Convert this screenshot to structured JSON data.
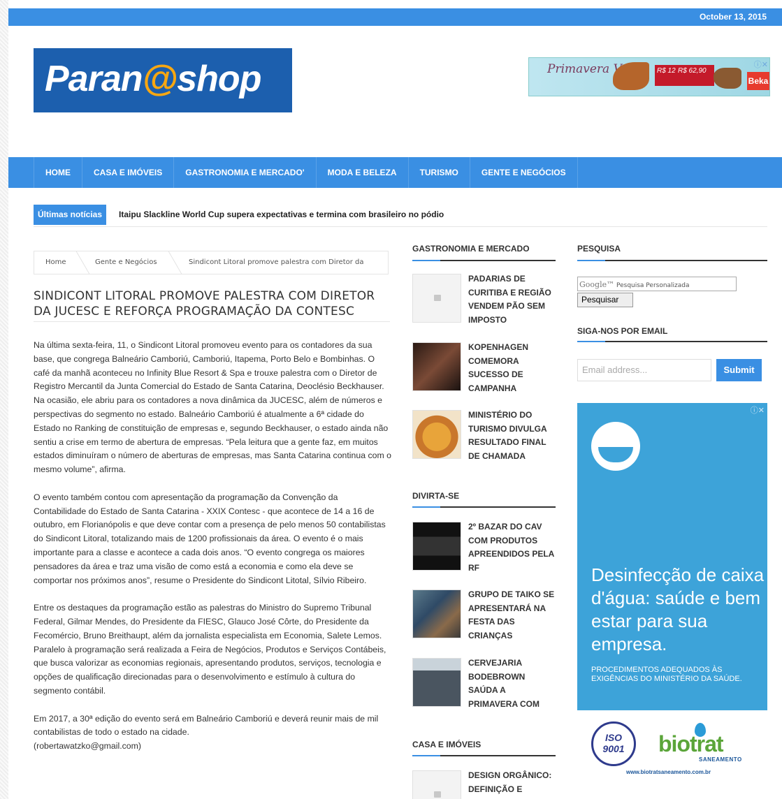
{
  "header": {
    "date": "October 13, 2015",
    "logo_text_1": "Paran",
    "logo_text_2": "@shop",
    "logo_text_3": "shop"
  },
  "top_ad": {
    "script_text": "Primavera Verão",
    "price_1": "R$ 123,50",
    "price_2": "R$ 62,90",
    "brand": "Beka",
    "info_icon": "ⓘ✕"
  },
  "nav": {
    "items": [
      "HOME",
      "CASA E IMÓVEIS",
      "GASTRONOMIA E MERCADO'",
      "MODA E BELEZA",
      "TURISMO",
      "GENTE E NEGÓCIOS"
    ]
  },
  "ticker": {
    "label": "Últimas notícias",
    "headline": "Itaipu Slackline World Cup supera expectativas e termina com brasileiro no pódio"
  },
  "breadcrumb": {
    "home": "Home",
    "section": "Gente e Negócios",
    "current": "Sindicont Litoral promove palestra com Diretor da"
  },
  "article": {
    "title": "SINDICONT LITORAL PROMOVE PALESTRA COM DIRETOR DA JUCESC E REFORÇA PROGRAMAÇÃO DA CONTESC",
    "paragraphs": [
      "Na última sexta-feira, 11, o Sindicont Litoral promoveu evento para os contadores da sua base, que congrega Balneário Camboriú, Camboriú, Itapema, Porto Belo e Bombinhas. O café da manhã aconteceu no Infinity Blue Resort & Spa e trouxe palestra com o Diretor de Registro Mercantil da Junta Comercial do Estado de Santa Catarina, Deoclésio Beckhauser. Na ocasião, ele abriu para os contadores a nova dinâmica da JUCESC, além de números e perspectivas do segmento no estado. Balneário Camboriú é atualmente a 6ª cidade do Estado no Ranking de constituição de empresas e, segundo Beckhauser, o estado ainda não sentiu a crise em termo de abertura de empresas. “Pela leitura que a gente faz, em muitos estados diminuíram o número de aberturas de empresas, mas Santa Catarina continua com o mesmo volume”, afirma.",
      "O evento também contou com apresentação da programação da Convenção da Contabilidade do Estado de Santa Catarina - XXIX Contesc - que acontece de 14 a 16 de outubro, em Florianópolis e que deve contar com a presença de pelo menos 50 contabilistas do Sindicont Litoral, totalizando mais de 1200 profissionais da área. O evento é o mais importante para a classe e acontece a cada dois anos. “O evento congrega os maiores pensadores da área e traz uma visão de como está a economia e como ela deve se comportar nos próximos anos”, resume o Presidente do Sindicont Litotal, Sílvio Ribeiro.",
      "Entre os destaques da programação estão as palestras do Ministro do Supremo Tribunal Federal, Gilmar Mendes, do Presidente da FIESC, Glauco José Côrte, do Presidente da Fecomércio, Bruno Breithaupt, além da jornalista especialista em Economia, Salete Lemos. Paralelo à programação será realizada a Feira de Negócios, Produtos e Serviços Contábeis, que busca valorizar as economias regionais, apresentando produtos, serviços, tecnologia e opções de qualificação direcionadas para o desenvolvimento e estímulo à cultura do segmento contábil.",
      "Em 2017, a 30ª edição do evento será em Balneário Camboriú e deverá reunir mais de mil contabilistas de todo o estado na cidade.",
      "(robertawatzko@gmail.com)"
    ]
  },
  "sidebar_middle": {
    "gastronomia": {
      "heading": "GASTRONOMIA E MERCADO",
      "posts": [
        "PADARIAS DE CURITIBA E REGIÃO VENDEM PÃO SEM IMPOSTO",
        "KOPENHAGEN COMEMORA SUCESSO DE CAMPANHA",
        "MINISTÉRIO DO TURISMO DIVULGA RESULTADO FINAL DE CHAMADA"
      ]
    },
    "divirta": {
      "heading": "DIVIRTA-SE",
      "posts": [
        "2º BAZAR DO CAV COM PRODUTOS APREENDIDOS PELA RF",
        "GRUPO DE TAIKO SE APRESENTARÁ NA FESTA DAS CRIANÇAS",
        "CERVEJARIA BODEBROWN SAÚDA A PRIMAVERA COM"
      ]
    },
    "casa": {
      "heading": "CASA E IMÓVEIS",
      "posts": [
        "DESIGN ORGÂNICO: DEFINIÇÃO E"
      ]
    }
  },
  "sidebar_right": {
    "search_heading": "PESQUISA",
    "google_label": "Google™",
    "search_placeholder": "Pesquisa Personalizada",
    "search_button": "Pesquisar",
    "email_heading": "SIGA-NOS POR EMAIL",
    "email_placeholder": "Email address...",
    "submit_button": "Submit",
    "ad": {
      "info_icon": "ⓘ✕",
      "headline": "Desinfecção de caixa d'água: saúde e bem estar para sua empresa.",
      "small": "PROCEDIMENTOS ADEQUADOS ÀS EXIGÊNCIAS DO MINISTÉRIO DA SAÚDE.",
      "iso": "ISO 9001",
      "brand": "biotrat",
      "brand_sub": "SANEAMENTO",
      "url": "www.biotratsaneamento.com.br"
    }
  }
}
